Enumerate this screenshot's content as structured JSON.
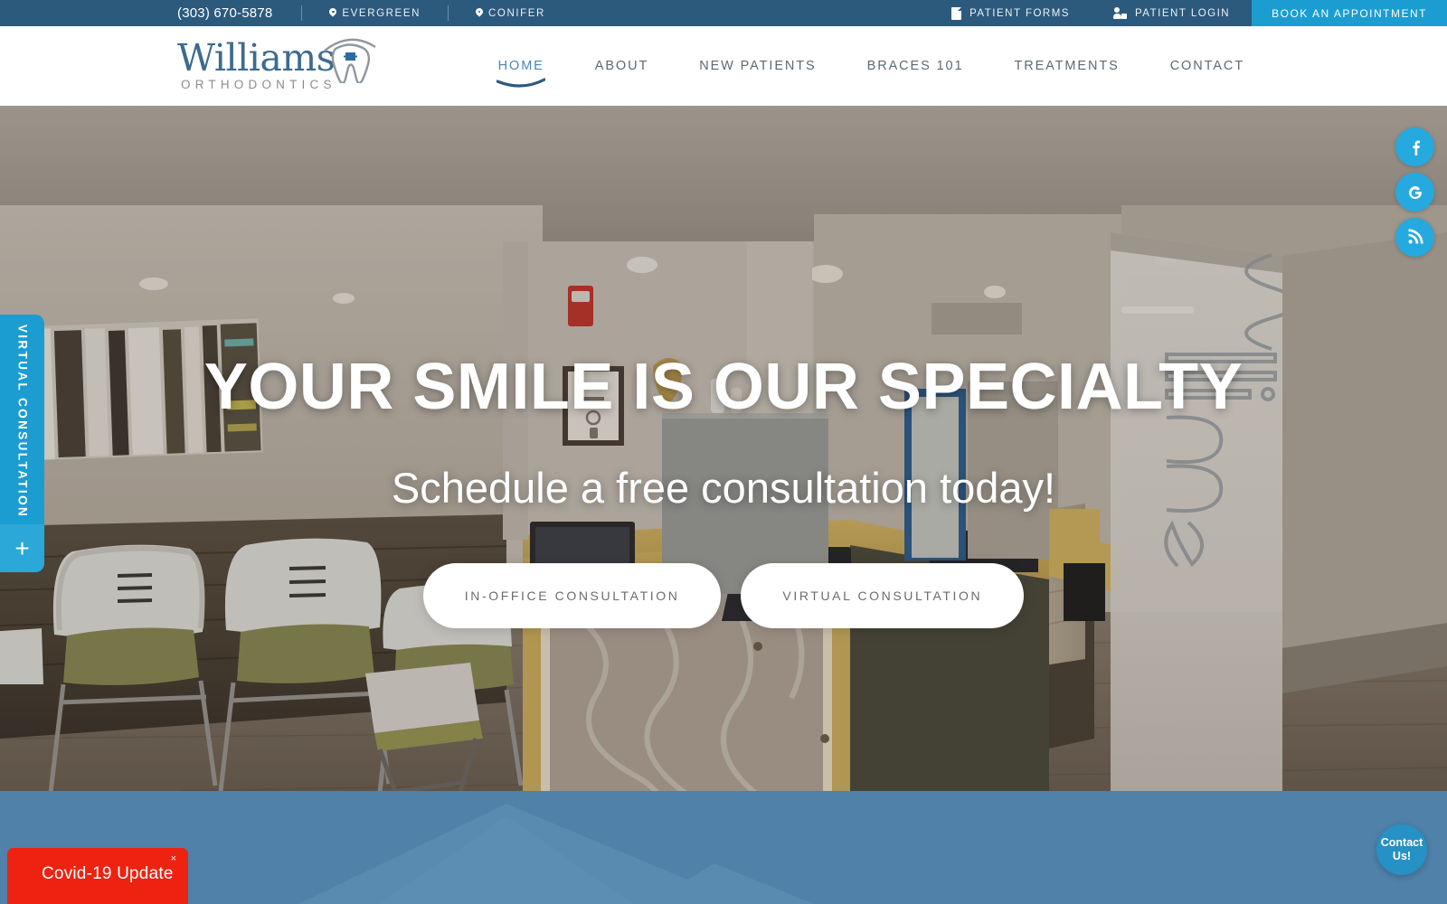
{
  "topbar": {
    "phone": "(303) 670-5878",
    "locations": [
      {
        "icon": "map-pin-icon",
        "label": "EVERGREEN"
      },
      {
        "icon": "map-pin-icon",
        "label": "CONIFER"
      }
    ],
    "links": [
      {
        "icon": "document-icon",
        "label": "PATIENT FORMS"
      },
      {
        "icon": "user-login-icon",
        "label": "PATIENT LOGIN"
      }
    ],
    "cta": "BOOK AN APPOINTMENT",
    "bg_color": "#2c5a7d",
    "cta_color": "#1b9dd1"
  },
  "header": {
    "logo": {
      "word": "Williams",
      "subtitle": "ORTHODONTICS",
      "icon": "tooth-with-braces-icon",
      "word_color": "#3d6b8f",
      "subtitle_color": "#8c8c8c"
    },
    "nav": [
      {
        "label": "HOME",
        "active": true
      },
      {
        "label": "ABOUT",
        "active": false
      },
      {
        "label": "NEW PATIENTS",
        "active": false
      },
      {
        "label": "BRACES 101",
        "active": false
      },
      {
        "label": "TREATMENTS",
        "active": false
      },
      {
        "label": "CONTACT",
        "active": false
      }
    ],
    "active_color": "#4a87b5",
    "inactive_color": "#5a6a75"
  },
  "hero": {
    "title": "YOUR SMILE IS OUR SPECIALTY",
    "subtitle": "Schedule a free consultation today!",
    "buttons": [
      {
        "label": "IN-OFFICE CONSULTATION"
      },
      {
        "label": "VIRTUAL CONSULTATION"
      }
    ],
    "background_description": "Orthodontic office reception area with waiting chairs and front desk"
  },
  "social_rail": [
    {
      "icon": "facebook-icon",
      "glyph": "f"
    },
    {
      "icon": "google-icon",
      "glyph": "G"
    },
    {
      "icon": "rss-feed-icon",
      "glyph": "rss"
    }
  ],
  "virtual_tab": {
    "label": "VIRTUAL CONSULTATION",
    "expand": "+",
    "color": "#1b9dd1"
  },
  "covid_banner": {
    "label": "Covid-19 Update",
    "close": "×",
    "color": "#ee2211"
  },
  "contact_bubble": {
    "line1": "Contact",
    "line2": "Us!",
    "color": "#2591c4"
  },
  "bottom_band": {
    "color": "#4f81a9",
    "graphic": "mountain-silhouette"
  }
}
